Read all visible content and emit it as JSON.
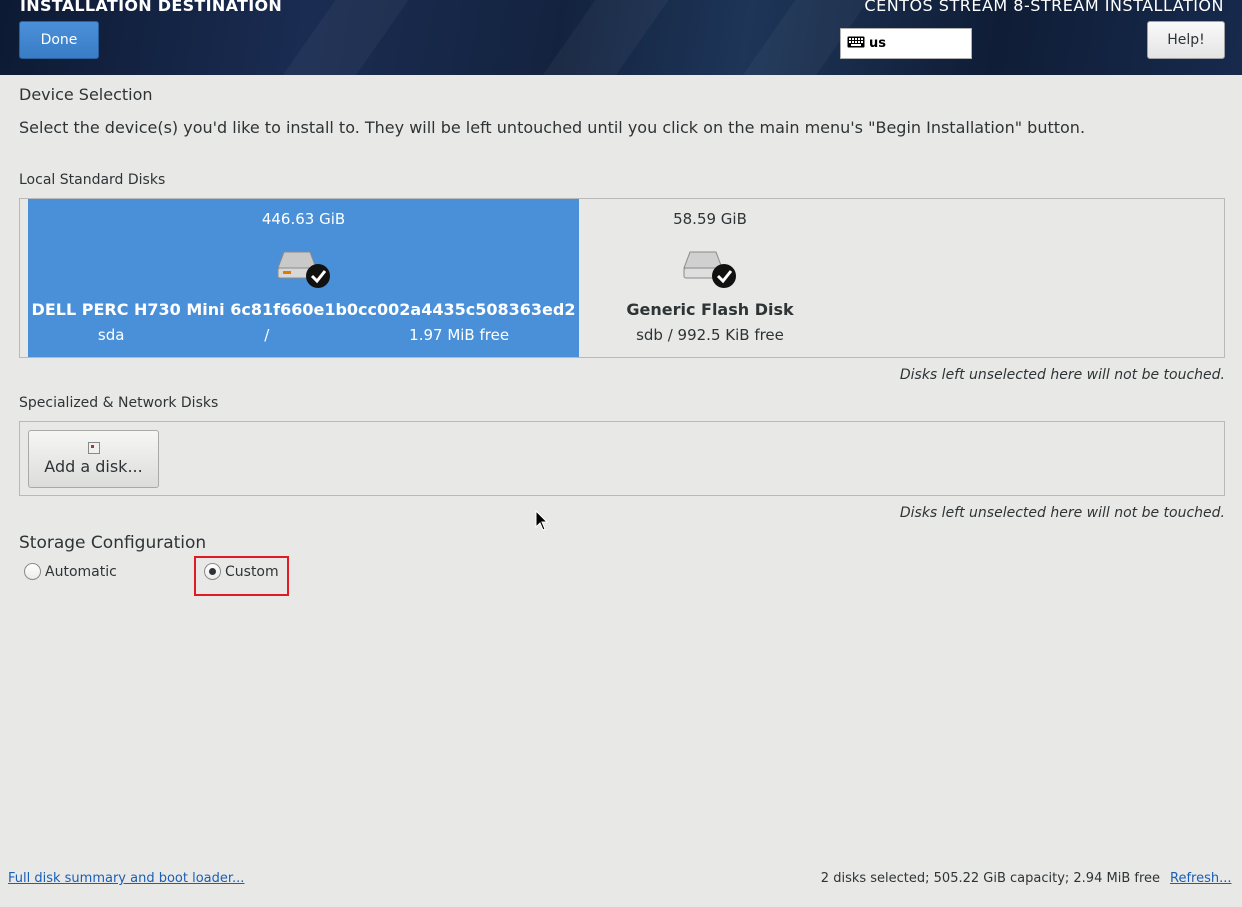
{
  "header": {
    "page_title": "INSTALLATION DESTINATION",
    "product_title": "CENTOS STREAM 8-STREAM INSTALLATION",
    "done_label": "Done",
    "keyboard_layout": "us",
    "keyboard_icon": "keyboard-icon",
    "help_label": "Help!"
  },
  "device_selection": {
    "title": "Device Selection",
    "description": "Select the device(s) you'd like to install to.  They will be left untouched until you click on the main menu's \"Begin Installation\" button."
  },
  "local_disks": {
    "title": "Local Standard Disks",
    "disks": [
      {
        "size": "446.63 GiB",
        "name": "DELL PERC H730 Mini 6c81f660e1b0cc002a4435c508363ed2",
        "device": "sda",
        "separator": "/",
        "free": "1.97 MiB free",
        "selected": true,
        "icon": "hard-disk-checked-icon"
      },
      {
        "size": "58.59 GiB",
        "name": "Generic Flash Disk",
        "info": "sdb  /  992.5 KiB free",
        "selected": true,
        "icon": "flash-disk-checked-icon"
      }
    ],
    "note": "Disks left unselected here will not be touched."
  },
  "specialized_disks": {
    "title": "Specialized & Network Disks",
    "add_label": "Add a disk...",
    "note": "Disks left unselected here will not be touched."
  },
  "storage_config": {
    "title": "Storage Configuration",
    "options": [
      {
        "label": "Automatic",
        "checked": false
      },
      {
        "label": "Custom",
        "checked": true
      }
    ]
  },
  "footer": {
    "summary_link": "Full disk summary and boot loader...",
    "status": "2 disks selected; 505.22 GiB capacity; 2.94 MiB free",
    "refresh_link": "Refresh..."
  },
  "colors": {
    "selected_disk_bg": "#4a90d9",
    "header_bg": "#13233f",
    "highlight": "#e01b24",
    "link": "#1a5fb4"
  }
}
